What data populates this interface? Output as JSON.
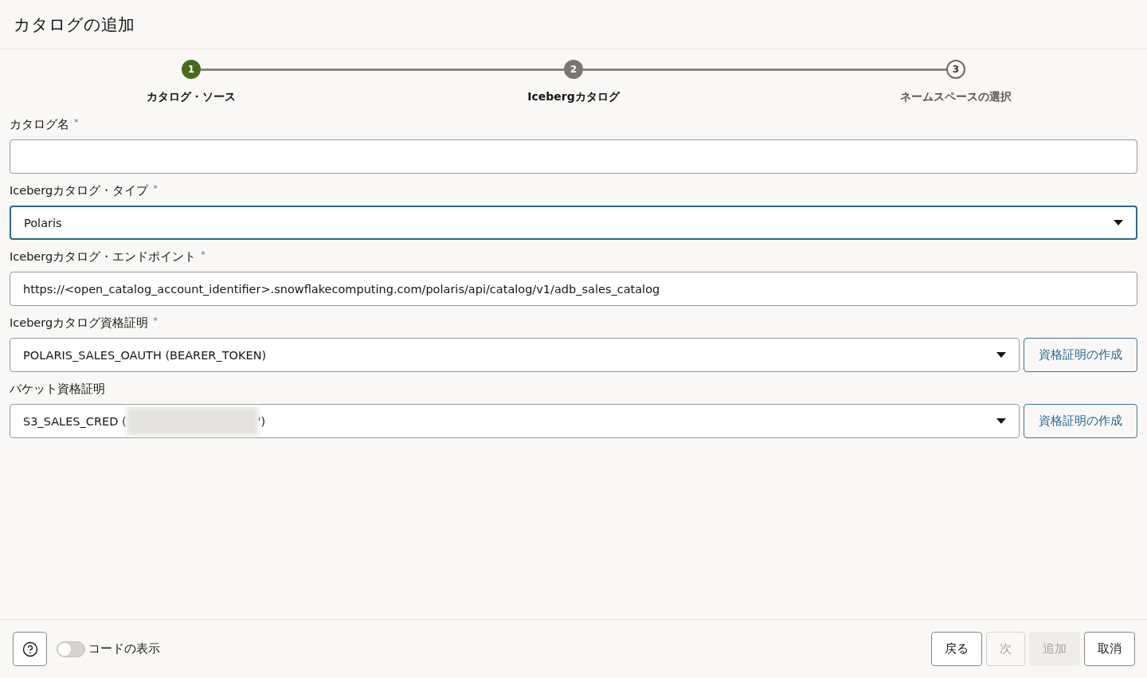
{
  "window": {
    "title": "カタログの追加"
  },
  "steps": [
    {
      "number": "1",
      "label": "カタログ・ソース",
      "selected": true,
      "visited": true
    },
    {
      "number": "2",
      "label": "Icebergカタログ",
      "selected": false,
      "visited": true
    },
    {
      "number": "3",
      "label": "ネームスペースの選択",
      "selected": false,
      "visited": false
    }
  ],
  "required_mark": "*",
  "fields": [
    {
      "kind": "text",
      "label": "カタログ名",
      "required": true,
      "focused": false
    },
    {
      "kind": "select",
      "label": "Icebergカタログ・タイプ",
      "required": true,
      "focused": true,
      "value": "Polaris"
    },
    {
      "kind": "text",
      "label": "Icebergカタログ・エンドポイント",
      "required": true,
      "focused": false,
      "value": "https://<open_catalog_account_identifier>.snowflakecomputing.com/polaris/api/catalog/v1/adb_sales_catalog"
    },
    {
      "kind": "select",
      "label": "Icebergカタログ資格証明",
      "required": true,
      "focused": false,
      "value": "POLARIS_SALES_OAUTH (BEARER_TOKEN)",
      "button": "資格証明の作成"
    },
    {
      "kind": "select",
      "label": "バケット資格証明",
      "required": false,
      "focused": false,
      "value": "S3_SALES_CRED (",
      "redacted": true,
      "value_after": "')",
      "button": "資格証明の作成"
    }
  ],
  "footer": {
    "toggle": {
      "label": "コードの表示",
      "on": false
    },
    "buttons": [
      {
        "label": "戻る",
        "kind": "outline",
        "disabled": false
      },
      {
        "label": "次",
        "kind": "outline",
        "disabled": true
      },
      {
        "label": "追加",
        "kind": "primary",
        "disabled": true
      },
      {
        "label": "取消",
        "kind": "outline",
        "disabled": false
      }
    ]
  }
}
